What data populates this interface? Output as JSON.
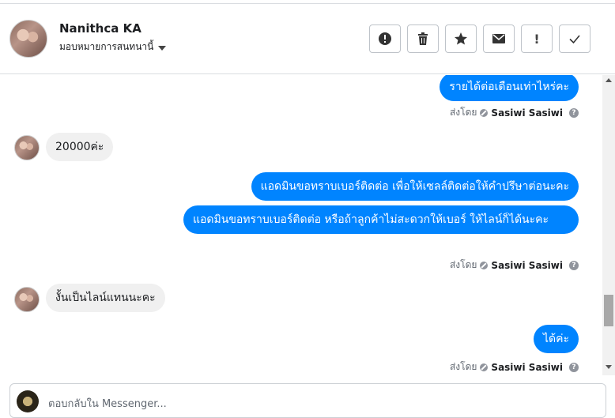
{
  "header": {
    "name": "Nanithca KA",
    "assign_label": "มอบหมายการสนทนานี้",
    "actions": [
      {
        "icon": "alert-circle-icon",
        "label": "mark-spam"
      },
      {
        "icon": "trash-icon",
        "label": "delete"
      },
      {
        "icon": "star-icon",
        "label": "star"
      },
      {
        "icon": "envelope-icon",
        "label": "mark-unread"
      },
      {
        "icon": "exclamation-icon",
        "label": "follow-up"
      },
      {
        "icon": "check-icon",
        "label": "done"
      }
    ]
  },
  "messages": [
    {
      "dir": "out",
      "text": "รายได้ต่อเดือนเท่าไหร่คะ"
    },
    {
      "dir": "sent_by",
      "prefix": "ส่งโดย",
      "name": "Sasiwi Sasiwi"
    },
    {
      "dir": "in",
      "text": "20000ค่ะ"
    },
    {
      "dir": "out",
      "text": "แอดมินขอทราบเบอร์ติดต่อ เพื่อให้เซลล์ติดต่อให้คำปรึษาต่อนะคะ"
    },
    {
      "dir": "out",
      "text": "แอดมินขอทราบเบอร์ติดต่อ หรือถ้าลูกค้าไม่สะดวกให้เบอร์ ให้ไลน์ก็ได้นะคะ"
    },
    {
      "dir": "sent_by",
      "prefix": "ส่งโดย",
      "name": "Sasiwi Sasiwi"
    },
    {
      "dir": "in",
      "text": "งั้นเป็นไลน์แทนนะคะ"
    },
    {
      "dir": "out",
      "text": "ได้ค่ะ"
    },
    {
      "dir": "sent_by",
      "prefix": "ส่งโดย",
      "name": "Sasiwi Sasiwi"
    }
  ],
  "composer": {
    "placeholder": "ตอบกลับใน Messenger..."
  },
  "colors": {
    "outgoing_bubble": "#0084ff",
    "incoming_bubble": "#f0f0f0"
  }
}
